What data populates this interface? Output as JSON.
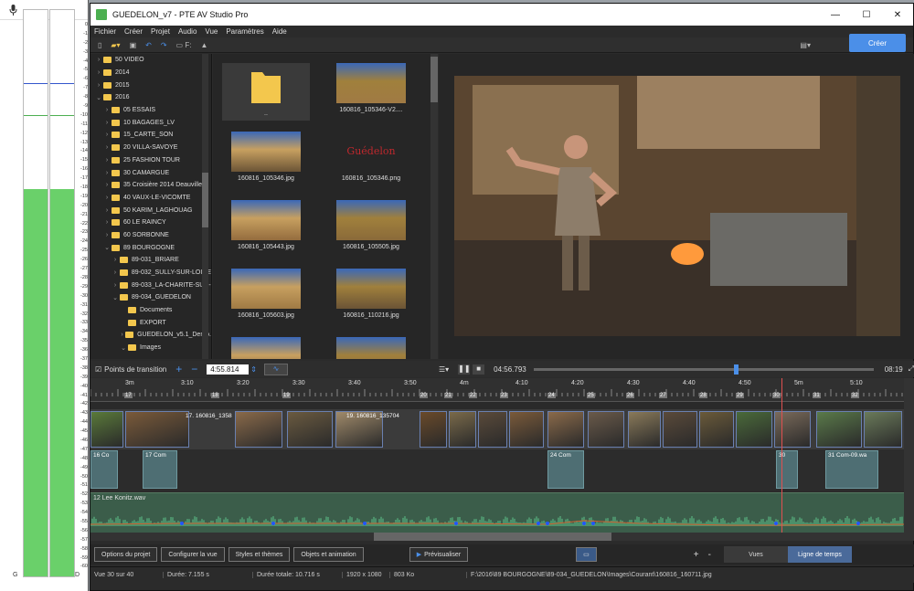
{
  "vu_meter": {
    "scale": [
      "0",
      "-1",
      "-2",
      "-3",
      "-4",
      "-5",
      "-6",
      "-7",
      "-8",
      "-9",
      "-10",
      "-11",
      "-12",
      "-13",
      "-14",
      "-15",
      "-16",
      "-17",
      "-18",
      "-19",
      "-20",
      "-21",
      "-22",
      "-23",
      "-24",
      "-25",
      "-26",
      "-27",
      "-28",
      "-29",
      "-30",
      "-31",
      "-32",
      "-33",
      "-34",
      "-35",
      "-36",
      "-37",
      "-38",
      "-39",
      "-40",
      "-41",
      "-42",
      "-43",
      "-44",
      "-45",
      "-46",
      "-47",
      "-48",
      "-49",
      "-50",
      "-51",
      "-52",
      "-53",
      "-54",
      "-55",
      "-56",
      "-57",
      "-58",
      "-59",
      "-60"
    ],
    "left_label": "G",
    "right_label": "D",
    "fill_color": "#6ad06a"
  },
  "window": {
    "title": "GUEDELON_v7 - PTE AV Studio Pro"
  },
  "menu": [
    "Fichier",
    "Créer",
    "Projet",
    "Audio",
    "Vue",
    "Paramètres",
    "Aide"
  ],
  "toolbar": {
    "drive": "F:",
    "create_button": "Créer"
  },
  "tree": {
    "items": [
      {
        "label": "50 VIDEO",
        "indent": 1,
        "chev": "›"
      },
      {
        "label": "2014",
        "indent": 1,
        "chev": "›"
      },
      {
        "label": "2015",
        "indent": 1,
        "chev": "›"
      },
      {
        "label": "2016",
        "indent": 1,
        "chev": "⌄"
      },
      {
        "label": "05 ESSAIS",
        "indent": 2,
        "chev": "›"
      },
      {
        "label": "10 BAGAGES_LV",
        "indent": 2,
        "chev": "›"
      },
      {
        "label": "15_CARTE_SON",
        "indent": 2,
        "chev": "›"
      },
      {
        "label": "20 VILLA-SAVOYE",
        "indent": 2,
        "chev": "›"
      },
      {
        "label": "25 FASHION TOUR",
        "indent": 2,
        "chev": "›"
      },
      {
        "label": "30 CAMARGUE",
        "indent": 2,
        "chev": "›"
      },
      {
        "label": "35 Croisière 2014 DeauvilleR",
        "indent": 2,
        "chev": "›"
      },
      {
        "label": "40 VAUX-LE-VICOMTE",
        "indent": 2,
        "chev": "›"
      },
      {
        "label": "50 KARIM_LAGHOUAG",
        "indent": 2,
        "chev": "›"
      },
      {
        "label": "60 LE RAINCY",
        "indent": 2,
        "chev": "›"
      },
      {
        "label": "60 SORBONNE",
        "indent": 2,
        "chev": "›"
      },
      {
        "label": "89 BOURGOGNE",
        "indent": 2,
        "chev": "⌄"
      },
      {
        "label": "89-031_BRIARE",
        "indent": 3,
        "chev": "›"
      },
      {
        "label": "89-032_SULLY-SUR-LOIRE",
        "indent": 3,
        "chev": "›"
      },
      {
        "label": "89-033_LA-CHARITE-SUR-",
        "indent": 3,
        "chev": "›"
      },
      {
        "label": "89-034_GUEDELON",
        "indent": 3,
        "chev": "⌄"
      },
      {
        "label": "Documents",
        "indent": 4,
        "chev": ""
      },
      {
        "label": "EXPORT",
        "indent": 4,
        "chev": ""
      },
      {
        "label": "GUEDELON_v5.1_Demo.",
        "indent": 4,
        "chev": "›"
      },
      {
        "label": "Images",
        "indent": 4,
        "chev": "⌄"
      }
    ]
  },
  "files": [
    {
      "label": "..",
      "kind": "folder"
    },
    {
      "label": "160816_105346-V2....",
      "kind": "photo"
    },
    {
      "label": "160816_105346.jpg",
      "kind": "photo"
    },
    {
      "label": "160816_105346.png",
      "kind": "logo",
      "logo_text": "Guédelon"
    },
    {
      "label": "160816_105443.jpg",
      "kind": "photo"
    },
    {
      "label": "160816_105505.jpg",
      "kind": "photo"
    },
    {
      "label": "160816_105603.jpg",
      "kind": "photo"
    },
    {
      "label": "160816_110216.jpg",
      "kind": "photo"
    },
    {
      "label": "",
      "kind": "photo"
    },
    {
      "label": "",
      "kind": "photo"
    }
  ],
  "timeline_bar": {
    "transition_label": "Points de transition",
    "time_value": "4:55.814",
    "current_time": "04:56.793",
    "end_time": "08:19",
    "progress": 0.59
  },
  "ruler": {
    "labels": [
      "3m",
      "3:10",
      "3:20",
      "3:30",
      "3:40",
      "3:50",
      "4m",
      "4:10",
      "4:20",
      "4:30",
      "4:40",
      "4:50",
      "5m",
      "5:10"
    ],
    "markers": [
      "17",
      "18",
      "19",
      "20",
      "21",
      "22",
      "23",
      "24",
      "25",
      "26",
      "27",
      "28",
      "29",
      "30",
      "31",
      "32"
    ]
  },
  "slides": [
    {
      "label": "17. 160816_1358"
    },
    {
      "label": "19. 160816_135704"
    }
  ],
  "objects": [
    {
      "label": "16 Co"
    },
    {
      "label": "17 Com"
    },
    {
      "label": "24 Com"
    },
    {
      "label": "30"
    },
    {
      "label": "31 Com-09.wa"
    }
  ],
  "audio_track": {
    "label": "12 Lee Konitz.wav"
  },
  "bottom": {
    "options": "Options du projet",
    "configure": "Configurer la vue",
    "styles": "Styles et thèmes",
    "objects": "Objets et animation",
    "preview": "Prévisualiser",
    "plus": "+",
    "minus": "-",
    "tab_views": "Vues",
    "tab_timeline": "Ligne de temps"
  },
  "status": {
    "slide": "Vue 30 sur 40",
    "duration": "Durée: 7.155 s",
    "total": "Durée totale: 10.716 s",
    "resolution": "1920 x 1080",
    "size": "803 Ko",
    "path": "F:\\2016\\89 BOURGOGNE\\89-034_GUEDELON\\Images\\Courant\\160816_160711.jpg"
  }
}
